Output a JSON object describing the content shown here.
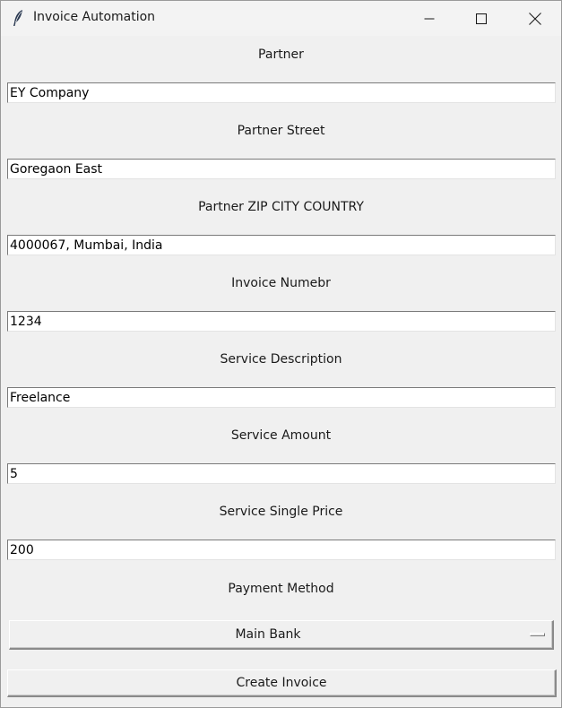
{
  "window": {
    "title": "Invoice Automation",
    "app_icon": "feather-icon"
  },
  "form": {
    "fields": [
      {
        "label": "Partner",
        "value": "EY Company"
      },
      {
        "label": "Partner Street",
        "value": "Goregaon East"
      },
      {
        "label": "Partner ZIP CITY COUNTRY",
        "value": "4000067, Mumbai, India"
      },
      {
        "label": "Invoice Numebr",
        "value": "1234"
      },
      {
        "label": "Service Description",
        "value": "Freelance"
      },
      {
        "label": "Service Amount",
        "value": "5"
      },
      {
        "label": "Service Single Price",
        "value": "200"
      }
    ],
    "payment": {
      "label": "Payment Method",
      "selected": "Main Bank"
    },
    "create_label": "Create Invoice"
  }
}
